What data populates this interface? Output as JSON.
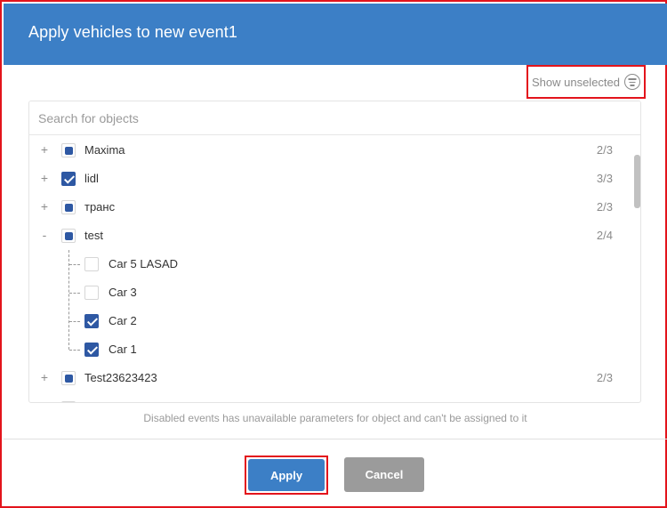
{
  "dialog": {
    "title": "Apply vehicles to new event1"
  },
  "filter": {
    "label": "Show unselected",
    "icon": "filter-icon"
  },
  "search": {
    "placeholder": "Search for objects",
    "value": ""
  },
  "tree": [
    {
      "type": "group",
      "toggle": "+",
      "state": "partial",
      "label": "Maxima",
      "count": "2/3"
    },
    {
      "type": "group",
      "toggle": "+",
      "state": "checked",
      "label": "lidl",
      "count": "3/3"
    },
    {
      "type": "group",
      "toggle": "+",
      "state": "partial",
      "label": "транс",
      "count": "2/3"
    },
    {
      "type": "group",
      "toggle": "-",
      "state": "partial",
      "label": "test",
      "count": "2/4"
    },
    {
      "type": "item",
      "state": "unchecked",
      "label": "Car 5 LASAD"
    },
    {
      "type": "item",
      "state": "unchecked",
      "label": "Car 3"
    },
    {
      "type": "item",
      "state": "checked",
      "label": "Car 2"
    },
    {
      "type": "item",
      "state": "checked",
      "label": "Car 1"
    },
    {
      "type": "group",
      "toggle": "+",
      "state": "partial",
      "label": "Test23623423",
      "count": "2/3"
    }
  ],
  "note": "Disabled events has unavailable parameters for object and can't be assigned to it",
  "buttons": {
    "apply": "Apply",
    "cancel": "Cancel"
  },
  "colors": {
    "header": "#3c7fc6",
    "accent": "#2e58a3",
    "highlight": "#e3141c",
    "cancel": "#9b9b9b"
  }
}
